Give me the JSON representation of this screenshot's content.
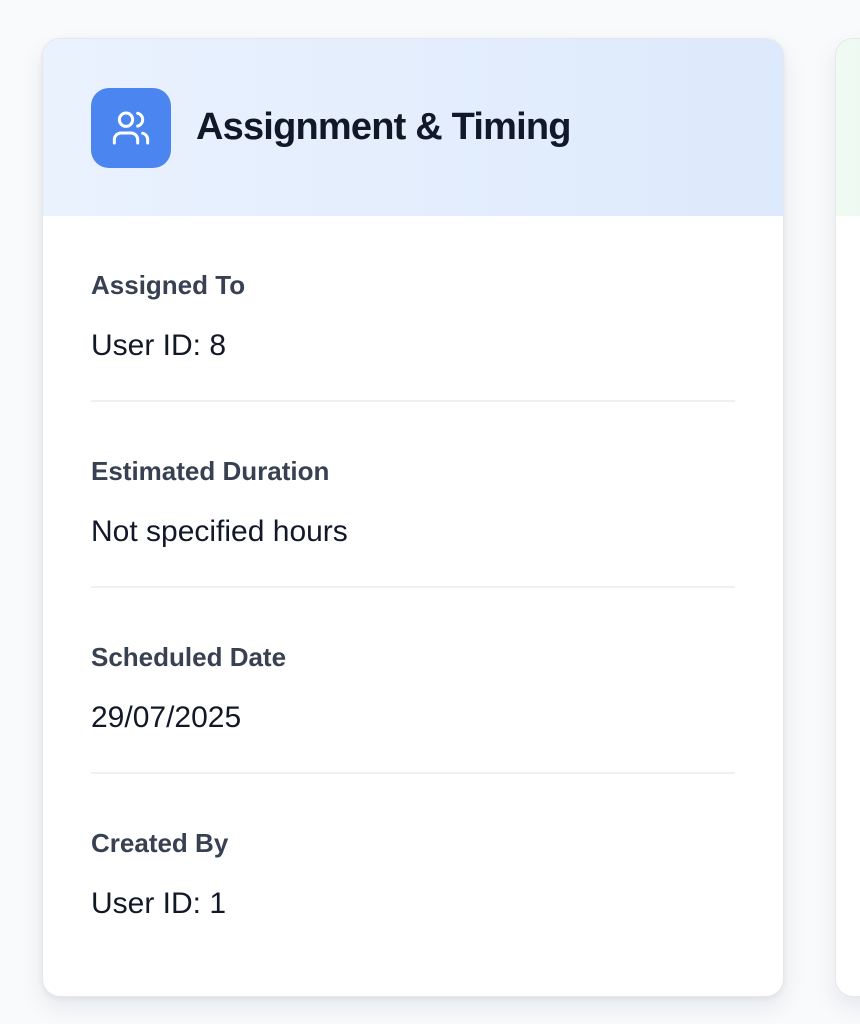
{
  "card": {
    "title": "Assignment & Timing",
    "icon": "users-icon",
    "accent_color": "#4b85ef",
    "fields": [
      {
        "label": "Assigned To",
        "value": "User ID: 8"
      },
      {
        "label": "Estimated Duration",
        "value": "Not specified hours"
      },
      {
        "label": "Scheduled Date",
        "value": "29/07/2025"
      },
      {
        "label": "Created By",
        "value": "User ID: 1"
      }
    ]
  }
}
